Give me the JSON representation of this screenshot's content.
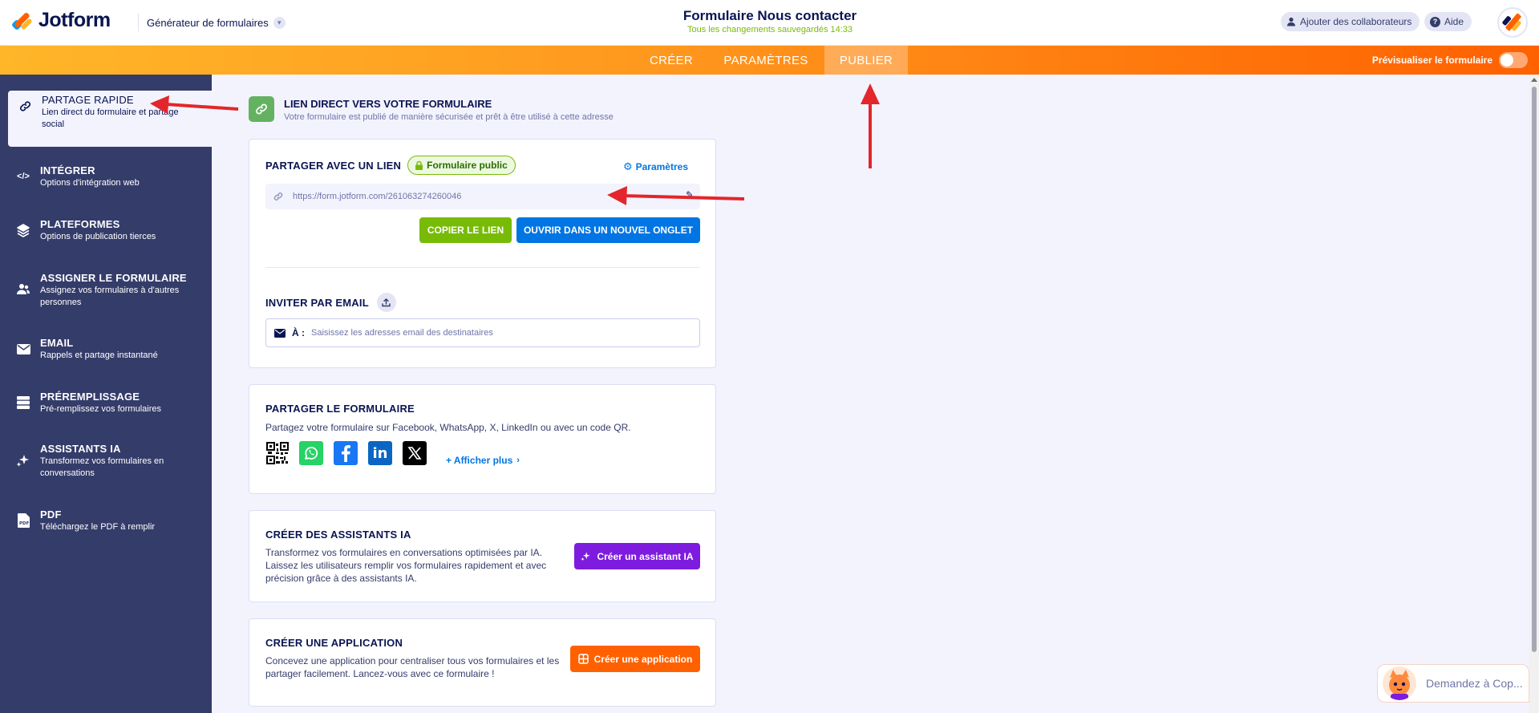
{
  "header": {
    "logo_text": "Jotform",
    "builder_label": "Générateur de formulaires",
    "form_title": "Formulaire Nous contacter",
    "save_status": "Tous les changements sauvegardés 14:33",
    "collaborators_label": "Ajouter des collaborateurs",
    "help_label": "Aide",
    "help_icon_glyph": "?"
  },
  "nav": {
    "tabs": [
      {
        "label": "CRÉER"
      },
      {
        "label": "PARAMÈTRES"
      },
      {
        "label": "PUBLIER"
      }
    ],
    "preview_label": "Prévisualiser le formulaire"
  },
  "sidebar": {
    "items": [
      {
        "title": "PARTAGE RAPIDE",
        "desc": "Lien direct du formulaire et partage social",
        "icon": "link-icon"
      },
      {
        "title": "INTÉGRER",
        "desc": "Options d'intégration web",
        "icon": "code-icon"
      },
      {
        "title": "PLATEFORMES",
        "desc": "Options de publication tierces",
        "icon": "layers-icon"
      },
      {
        "title": "ASSIGNER LE FORMULAIRE",
        "desc": "Assignez vos formulaires à d'autres personnes",
        "icon": "users-icon"
      },
      {
        "title": "EMAIL",
        "desc": "Rappels et partage instantané",
        "icon": "envelope-icon"
      },
      {
        "title": "PRÉREMPLISSAGE",
        "desc": "Pré-remplissez vos formulaires",
        "icon": "prefill-icon"
      },
      {
        "title": "ASSISTANTS IA",
        "desc": "Transformez vos formulaires en conversations",
        "icon": "sparkle-icon"
      },
      {
        "title": "PDF",
        "desc": "Téléchargez le PDF à remplir",
        "icon": "pdf-icon"
      }
    ]
  },
  "direct_link": {
    "title": "LIEN DIRECT VERS VOTRE FORMULAIRE",
    "subtitle": "Votre formulaire est publié de manière sécurisée et prêt à être utilisé à cette adresse"
  },
  "share_link": {
    "title": "PARTAGER AVEC UN LIEN",
    "badge": "Formulaire public",
    "settings_label": "Paramètres",
    "url": "https://form.jotform.com/261063274260046",
    "copy_label": "COPIER LE LIEN",
    "open_label": "OUVRIR DANS UN NOUVEL ONGLET",
    "invite_title": "INVITER PAR EMAIL",
    "to_label": "À :",
    "email_placeholder": "Saisissez les adresses email des destinataires"
  },
  "share_form": {
    "title": "PARTAGER LE FORMULAIRE",
    "text": "Partagez votre formulaire sur Facebook, WhatsApp, X, LinkedIn ou avec un code QR.",
    "more_label": "+ Afficher plus",
    "linkedin_glyph": "in",
    "socials": [
      "qr-code-icon",
      "whatsapp-icon",
      "facebook-icon",
      "linkedin-icon",
      "x-icon"
    ]
  },
  "ai_assistants": {
    "title": "CRÉER DES ASSISTANTS IA",
    "text": "Transformez vos formulaires en conversations optimisées par IA. Laissez les utilisateurs remplir vos formulaires rapidement et avec précision grâce à des assistants IA.",
    "button": "Créer un assistant IA"
  },
  "app": {
    "title": "CRÉER UNE APPLICATION",
    "text": "Concevez une application pour centraliser tous vos formulaires et les partager facilement. Lancez-vous avec ce formulaire !",
    "button": "Créer une application"
  },
  "copilot": {
    "label": "Demandez à Cop..."
  },
  "colors": {
    "sidebar": "#343c6a",
    "nav_start": "#ffb629",
    "nav_end": "#ff6100",
    "green_btn": "#78bb07",
    "blue_btn": "#0075e3",
    "purple_btn": "#7d1cdf",
    "orange_btn": "#ff6100",
    "arrow": "#e3262b"
  }
}
